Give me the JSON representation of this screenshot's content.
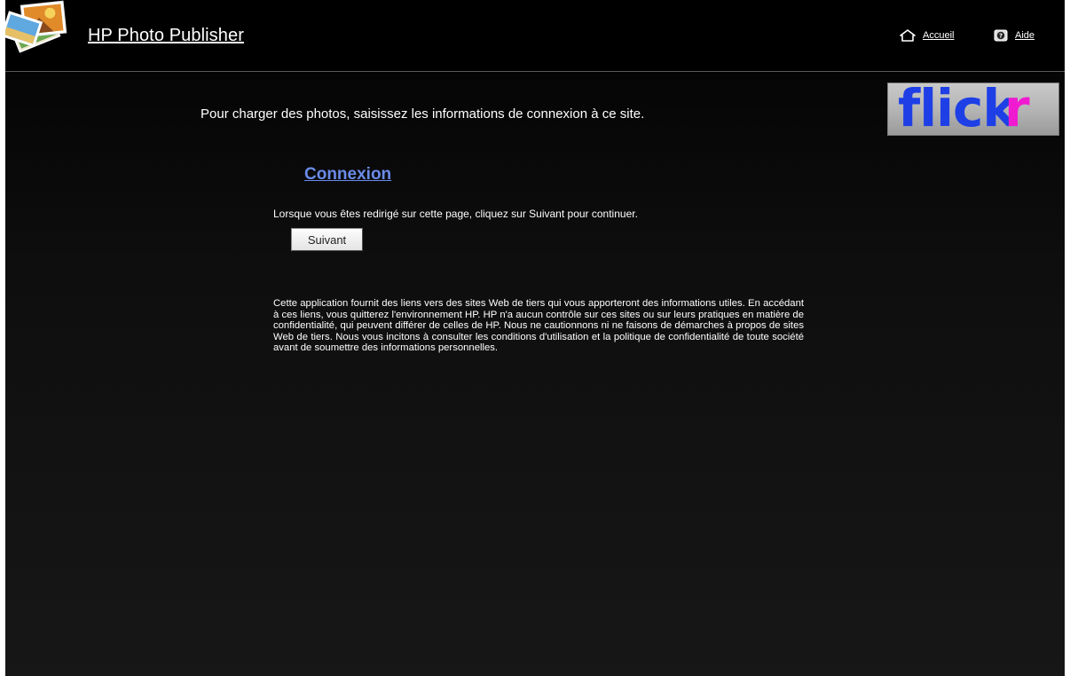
{
  "header": {
    "app_title": "HP Photo Publisher",
    "nav": {
      "home_label": "Accueil",
      "help_label": "Aide"
    }
  },
  "service": {
    "logo_text_main": "flick",
    "logo_text_accent": "r",
    "brand_blue": "#1e3fe6",
    "brand_pink": "#f01ad0"
  },
  "main": {
    "intro": "Pour charger des photos, saisissez les informations de connexion à ce site.",
    "section_title": "Connexion",
    "instruction": "Lorsque vous êtes redirigé sur cette page, cliquez sur Suivant pour continuer.",
    "next_button": "Suivant",
    "disclaimer": "Cette application fournit des liens vers des sites Web de tiers qui vous apporteront des informations utiles. En accédant à ces liens, vous quitterez l'environnement HP. HP n'a aucun contrôle sur ces sites ou sur leurs pratiques en matière de confidentialité, qui peuvent différer de celles de HP. Nous ne cautionnons ni ne faisons de démarches à propos de sites Web de tiers. Nous vous incitons à consulter les conditions d'utilisation et la politique de confidentialité de toute société avant de soumettre des informations personnelles."
  },
  "colors": {
    "background": "#000000",
    "link_blue": "#6a8be8",
    "text": "#ffffff"
  },
  "icons": {
    "logo": "photo-stack-icon",
    "home": "home-icon",
    "help": "help-icon"
  }
}
